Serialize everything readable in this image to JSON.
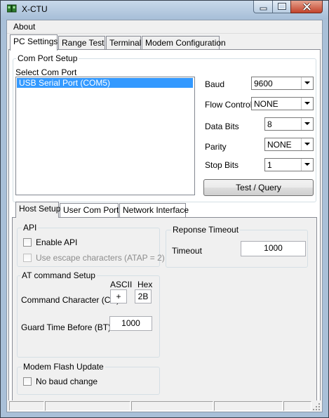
{
  "window": {
    "title": "X-CTU",
    "app_icon": "xctu-app-icon"
  },
  "menu": {
    "about": "About"
  },
  "tabs": [
    "PC Settings",
    "Range Test",
    "Terminal",
    "Modem Configuration"
  ],
  "com_port_setup": {
    "legend": "Com Port Setup",
    "select_label": "Select Com Port",
    "ports": [
      "USB Serial Port (COM5)"
    ],
    "selected_port": "USB Serial Port (COM5)"
  },
  "serial": {
    "baud_label": "Baud",
    "baud_value": "9600",
    "flow_label": "Flow Control",
    "flow_value": "NONE",
    "databits_label": "Data Bits",
    "databits_value": "8",
    "parity_label": "Parity",
    "parity_value": "NONE",
    "stopbits_label": "Stop Bits",
    "stopbits_value": "1",
    "test_button": "Test  / Query"
  },
  "subtabs": [
    "Host Setup",
    "User Com Ports",
    "Network Interface"
  ],
  "api": {
    "legend": "API",
    "enable_api": "Enable API",
    "enable_api_checked": false,
    "escape_chars": "Use escape characters (ATAP = 2)",
    "escape_chars_checked": false
  },
  "at_command": {
    "legend": "AT command Setup",
    "ascii_header": "ASCII",
    "hex_header": "Hex",
    "cc_label": "Command Character (CC)",
    "cc_ascii": "+",
    "cc_hex": "2B",
    "bt_label": "Guard Time Before (BT)",
    "bt_value": "1000"
  },
  "response_timeout": {
    "legend": "Reponse Timeout",
    "timeout_label": "Timeout",
    "timeout_value": "1000"
  },
  "modem_flash": {
    "legend": "Modem Flash Update",
    "no_baud_change": "No baud change",
    "no_baud_change_checked": false
  },
  "colors": {
    "titlebar": "#b7cde3",
    "selection": "#3399ff",
    "close_button": "#c3432b",
    "panel": "#f0f0f0"
  }
}
